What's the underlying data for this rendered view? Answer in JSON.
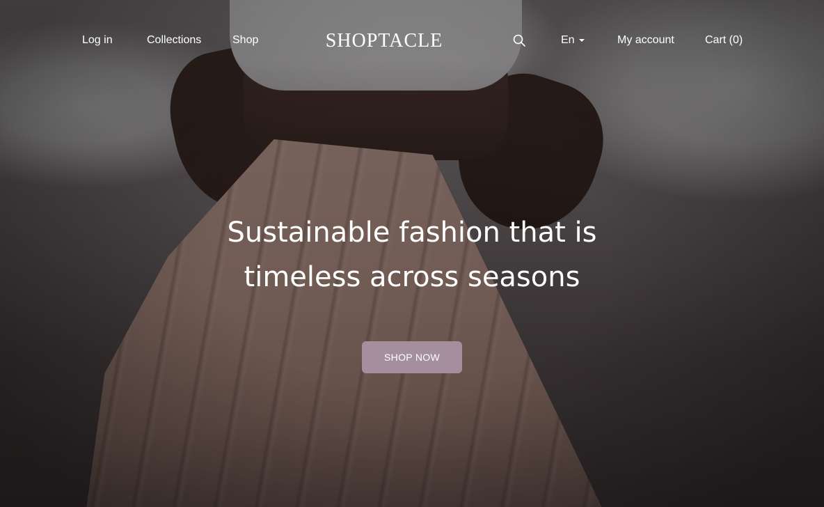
{
  "nav": {
    "login_label": "Log in",
    "collections_label": "Collections",
    "shop_label": "Shop",
    "logo_text": "SHOPTACLE",
    "search_icon": "search-icon",
    "language_label": "En",
    "language_icon": "caret-down-icon",
    "account_label": "My account",
    "cart_label": "Cart (0)"
  },
  "hero": {
    "headline_line1": "Sustainable fashion that is",
    "headline_line2": "timeless across seasons",
    "cta_label": "SHOP NOW"
  },
  "colors": {
    "cta_background": "#a58f9e",
    "text": "#ffffff",
    "overlay": "#141011"
  }
}
